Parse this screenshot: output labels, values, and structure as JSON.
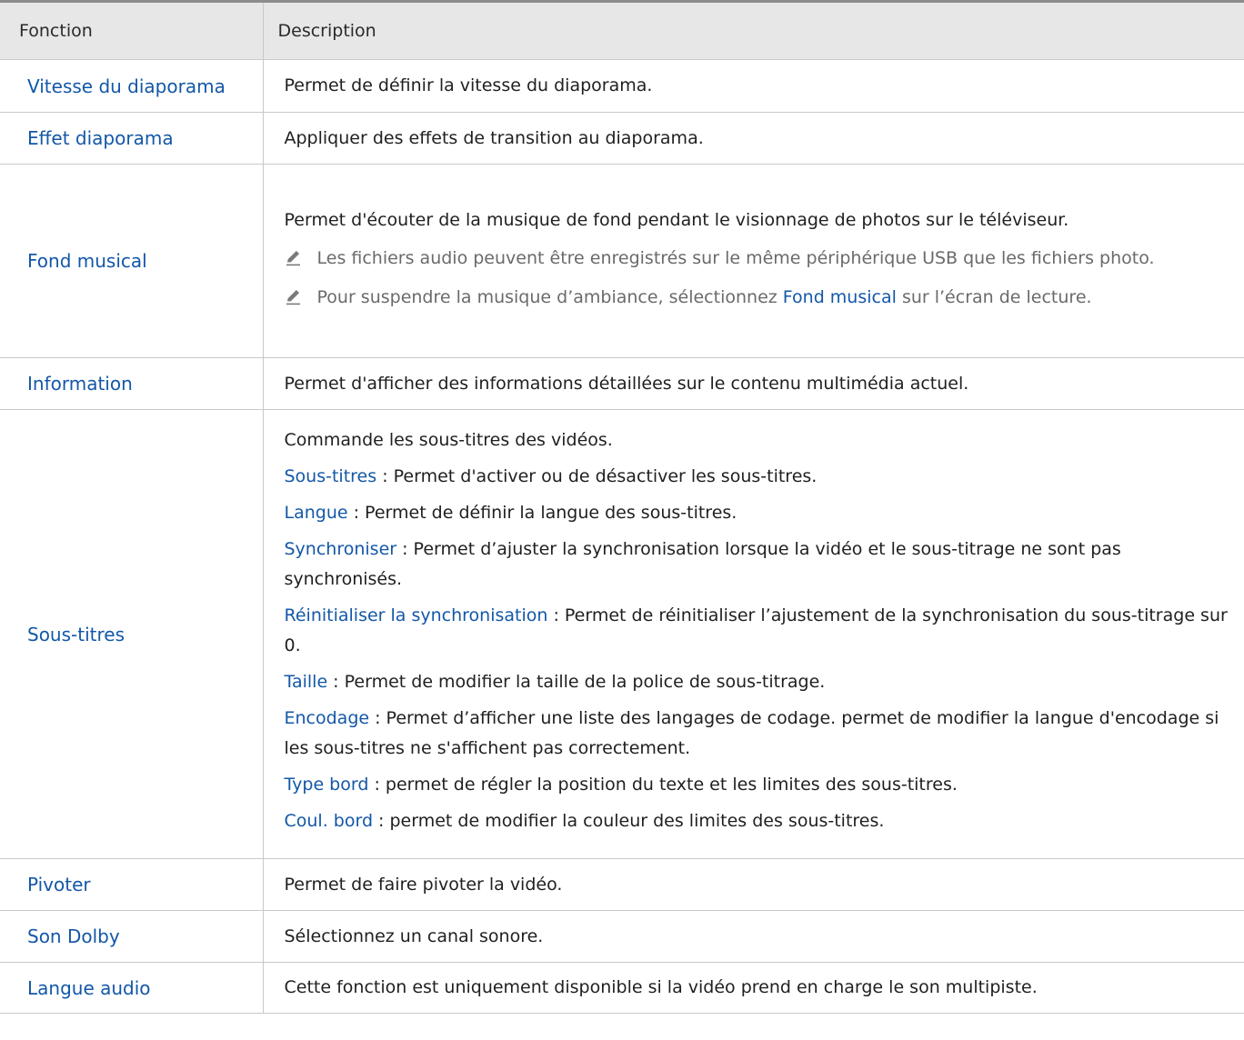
{
  "header": {
    "col1": "Fonction",
    "col2": "Description"
  },
  "icons": {
    "note": "pencil-icon"
  },
  "colors": {
    "link": "#1357a8",
    "header_bg": "#e7e7e7",
    "note_text": "#6a6a6a"
  },
  "rows": {
    "vitesse": {
      "name": "Vitesse du diaporama",
      "desc": "Permet de définir la vitesse du diaporama."
    },
    "effet": {
      "name": "Effet diaporama",
      "desc": "Appliquer des effets de transition au diaporama."
    },
    "fond": {
      "name": "Fond musical",
      "desc": "Permet d'écouter de la musique de fond pendant le visionnage de photos sur le téléviseur.",
      "note1": "Les fichiers audio peuvent être enregistrés sur le même périphérique USB que les fichiers photo.",
      "note2_before": "Pour suspendre la musique d’ambiance, sélectionnez ",
      "note2_link": "Fond musical",
      "note2_after": " sur l’écran de lecture."
    },
    "information": {
      "name": "Information",
      "desc": "Permet d'afficher des informations détaillées sur le contenu multimédia actuel."
    },
    "soustitres": {
      "name": "Sous-titres",
      "intro": "Commande les sous-titres des vidéos.",
      "items": [
        {
          "term": "Sous-titres",
          "text": " : Permet d'activer ou de désactiver les sous-titres."
        },
        {
          "term": "Langue",
          "text": " : Permet de définir la langue des sous-titres."
        },
        {
          "term": "Synchroniser",
          "text": " : Permet d’ajuster la synchronisation lorsque la vidéo et le sous-titrage ne sont pas synchronisés."
        },
        {
          "term": "Réinitialiser la synchronisation",
          "text": " : Permet de réinitialiser l’ajustement de la synchronisation du sous-titrage sur 0."
        },
        {
          "term": "Taille",
          "text": " : Permet de modifier la taille de la police de sous-titrage."
        },
        {
          "term": "Encodage",
          "text": " : Permet d’afficher une liste des langages de codage. permet de modifier la langue d'encodage si les sous-titres ne s'affichent pas correctement."
        },
        {
          "term": "Type bord",
          "text": " : permet de régler la position du texte et les limites des sous-titres."
        },
        {
          "term": "Coul. bord",
          "text": " : permet de modifier la couleur des limites des sous-titres."
        }
      ]
    },
    "pivoter": {
      "name": "Pivoter",
      "desc": "Permet de faire pivoter la vidéo."
    },
    "dolby": {
      "name": "Son Dolby",
      "desc": "Sélectionnez un canal sonore."
    },
    "langue_audio": {
      "name": "Langue audio",
      "desc": "Cette fonction est uniquement disponible si la vidéo prend en charge le son multipiste."
    }
  }
}
